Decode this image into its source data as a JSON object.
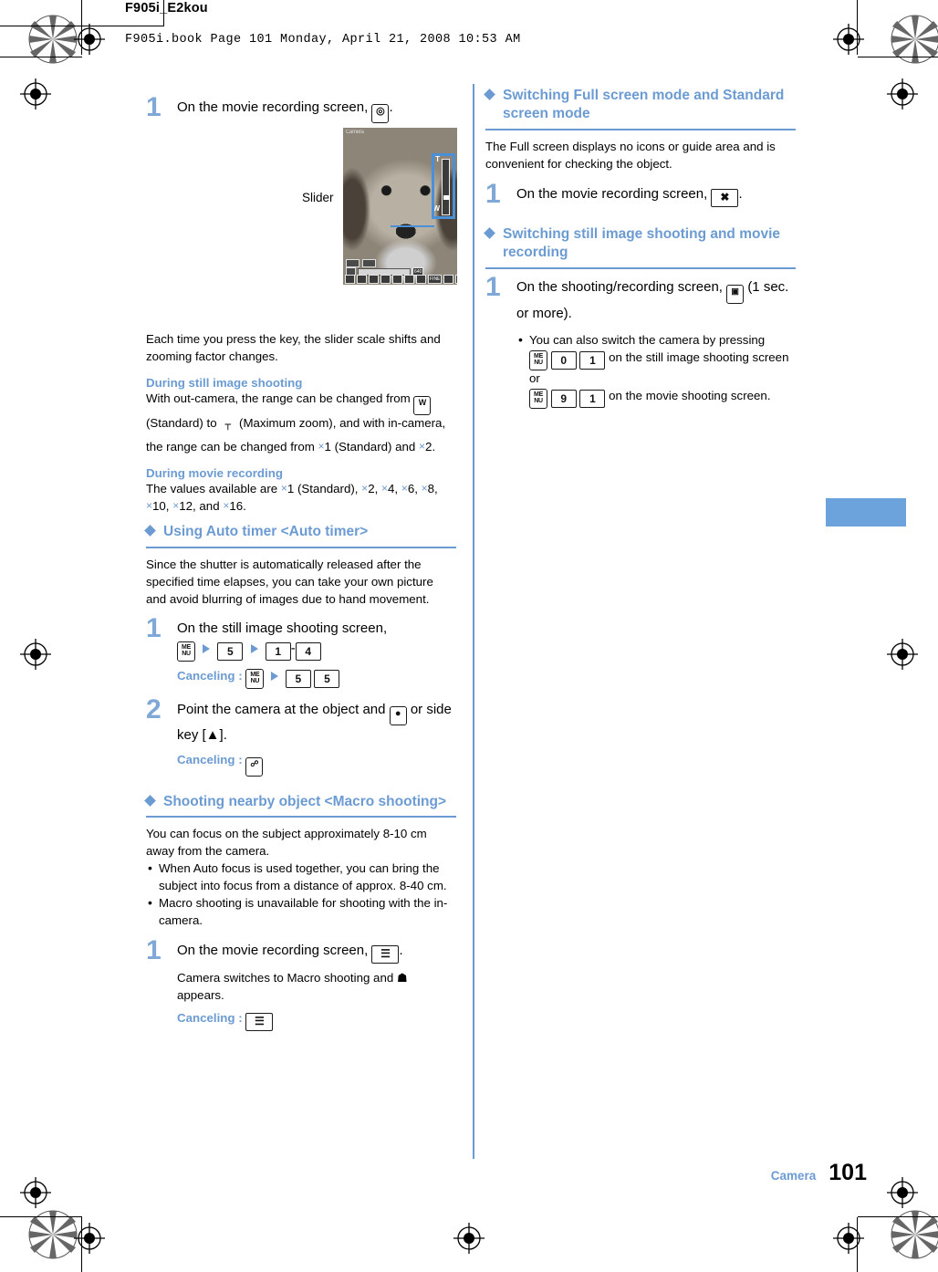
{
  "header": {
    "doc_id": "F905i_E2kou",
    "book_line": "F905i.book  Page 101  Monday, April 21, 2008  10:53 AM"
  },
  "colors": {
    "accent_blue": "#6b9bd2",
    "tab_blue": "#6da3dd",
    "step_number_blue": "#7fa8d6",
    "highlight_blue": "#4a90d9"
  },
  "left_column": {
    "step1": {
      "number": "1",
      "text_before": "On the movie recording screen,",
      "key_icon": "camera-zoom-key-icon",
      "text_after": "."
    },
    "figure": {
      "slider_label": "Slider",
      "screen_top_text": "Camera",
      "zoom_tele_label": "T",
      "zoom_wide_label": "W",
      "quality_label": "FINE",
      "memory_label": "640"
    },
    "after_figure": "Each time you press the key, the slider scale shifts and zooming factor changes.",
    "still_image_shooting": {
      "heading": "During still image shooting",
      "text_1": "With out-camera, the range can be changed from",
      "icon_w": "W",
      "text_2": "(Standard) to",
      "icon_t": "T",
      "text_3": "(Maximum zoom), and with in-camera, the range can be changed from",
      "times_1": "1 (Standard) and",
      "times_2": "2."
    },
    "movie_recording": {
      "heading": "During movie recording",
      "text": "The values available are",
      "values": [
        "1 (Standard),",
        "2,",
        "4,",
        "6,",
        "8,",
        "10,",
        "12, and",
        "16."
      ]
    },
    "auto_timer": {
      "heading": "Using Auto timer <Auto timer>",
      "body": "Since the shutter is automatically released after the specified time elapses, you can take your own picture and avoid blurring of images due to hand movement.",
      "step1": {
        "number": "1",
        "text": "On the still image shooting screen,",
        "keys": [
          "MENU",
          "5",
          "1",
          "-",
          "4"
        ],
        "canceling_label": "Canceling :",
        "canceling_keys": [
          "MENU",
          "5",
          "5"
        ]
      },
      "step2": {
        "number": "2",
        "text_before": "Point the camera at the object and",
        "key_icon": "center-select-key-icon",
        "text_after": "or side key [▲].",
        "canceling_label": "Canceling :",
        "canceling_key": "clear-key-icon"
      }
    },
    "macro": {
      "heading": "Shooting nearby object <Macro shooting>",
      "body": "You can focus on the subject approximately 8-10 cm away from the camera.",
      "notes": [
        "When Auto focus is used together, you can bring the subject into focus from a distance of approx. 8-40 cm.",
        "Macro shooting is unavailable for shooting with the in-camera."
      ],
      "step1": {
        "number": "1",
        "text_before": "On the movie recording screen,",
        "key_icon": "macro-key-icon",
        "text_after": ".",
        "sub_before": "Camera switches to Macro shooting and",
        "sub_icon": "macro-indicator-icon",
        "sub_after": "appears.",
        "canceling_label": "Canceling :",
        "canceling_key": "macro-key-icon"
      }
    }
  },
  "right_column": {
    "full_screen": {
      "heading": "Switching Full screen mode and Standard screen mode",
      "body": "The Full screen displays no icons or guide area and is convenient for checking the object.",
      "step1": {
        "number": "1",
        "text_before": "On the movie recording screen,",
        "key_icon": "full-screen-key-icon",
        "text_after": "."
      }
    },
    "switch_mode": {
      "heading": "Switching still image shooting and movie recording",
      "step1": {
        "number": "1",
        "text_before": "On the shooting/recording screen,",
        "key_icon": "camera-mode-key-icon",
        "text_after": "(1 sec. or more).",
        "note_before": "You can also switch the camera by pressing",
        "note_keys_1": [
          "MENU",
          "0",
          "1"
        ],
        "note_mid": "on the still image shooting screen or",
        "note_keys_2": [
          "MENU",
          "9",
          "1"
        ],
        "note_after": "on the movie shooting screen."
      }
    }
  },
  "footer": {
    "section": "Camera",
    "page_number": "101"
  }
}
